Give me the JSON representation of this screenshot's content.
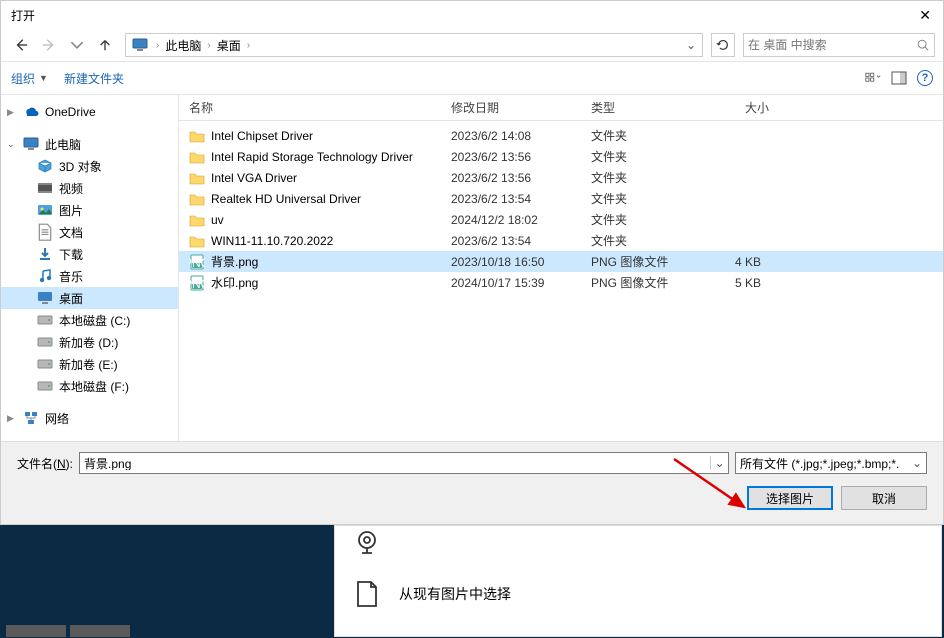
{
  "dialog": {
    "title": "打开",
    "breadcrumb": {
      "root": "此电脑",
      "current": "桌面"
    },
    "search_placeholder": "在 桌面 中搜索",
    "toolbar": {
      "organize": "组织",
      "new_folder": "新建文件夹"
    },
    "columns": {
      "name": "名称",
      "date": "修改日期",
      "type": "类型",
      "size": "大小"
    },
    "sidebar": {
      "onedrive": "OneDrive",
      "this_pc": "此电脑",
      "items": [
        {
          "label": "3D 对象",
          "icon": "3d"
        },
        {
          "label": "视频",
          "icon": "video"
        },
        {
          "label": "图片",
          "icon": "pictures"
        },
        {
          "label": "文档",
          "icon": "documents"
        },
        {
          "label": "下载",
          "icon": "downloads"
        },
        {
          "label": "音乐",
          "icon": "music"
        },
        {
          "label": "桌面",
          "icon": "desktop",
          "selected": true
        },
        {
          "label": "本地磁盘 (C:)",
          "icon": "drive"
        },
        {
          "label": "新加卷 (D:)",
          "icon": "drive"
        },
        {
          "label": "新加卷 (E:)",
          "icon": "drive"
        },
        {
          "label": "本地磁盘 (F:)",
          "icon": "drive"
        }
      ],
      "network": "网络"
    },
    "files": [
      {
        "name": "Intel Chipset Driver",
        "date": "2023/6/2 14:08",
        "type": "文件夹",
        "size": "",
        "kind": "folder"
      },
      {
        "name": "Intel Rapid Storage Technology Driver",
        "date": "2023/6/2 13:56",
        "type": "文件夹",
        "size": "",
        "kind": "folder"
      },
      {
        "name": "Intel VGA Driver",
        "date": "2023/6/2 13:56",
        "type": "文件夹",
        "size": "",
        "kind": "folder"
      },
      {
        "name": "Realtek HD Universal Driver",
        "date": "2023/6/2 13:54",
        "type": "文件夹",
        "size": "",
        "kind": "folder"
      },
      {
        "name": "uv",
        "date": "2024/12/2 18:02",
        "type": "文件夹",
        "size": "",
        "kind": "folder"
      },
      {
        "name": "WIN11-11.10.720.2022",
        "date": "2023/6/2 13:54",
        "type": "文件夹",
        "size": "",
        "kind": "folder"
      },
      {
        "name": "背景.png",
        "date": "2023/10/18 16:50",
        "type": "PNG 图像文件",
        "size": "4 KB",
        "kind": "png",
        "selected": true
      },
      {
        "name": "水印.png",
        "date": "2024/10/17 15:39",
        "type": "PNG 图像文件",
        "size": "5 KB",
        "kind": "png"
      }
    ],
    "footer": {
      "filename_label_pre": "文件名(",
      "filename_label_u": "N",
      "filename_label_post": "):",
      "filename_value": "背景.png",
      "filter": "所有文件 (*.jpg;*.jpeg;*.bmp;*.",
      "open_btn": "选择图片",
      "cancel_btn": "取消"
    }
  },
  "bgapp": {
    "option": "从现有图片中选择"
  }
}
